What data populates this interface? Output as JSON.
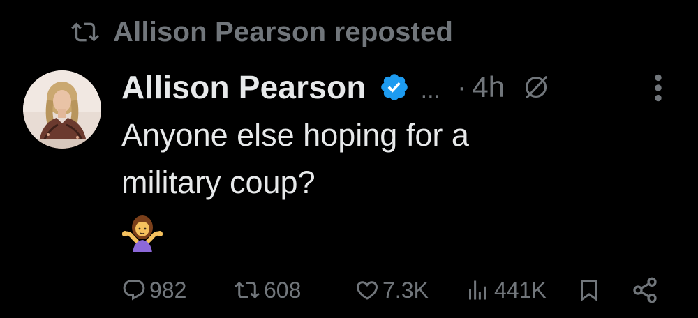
{
  "repost_banner": {
    "icon": "repost-icon",
    "text": "Allison Pearson reposted"
  },
  "post": {
    "author_name": "Allison Pearson",
    "verified_icon": "verified-badge-icon",
    "handle_truncated": "...",
    "separator": "·",
    "time": "4h",
    "grok_icon": "grok-icon",
    "more_icon": "more-options-icon",
    "text_line_1": "Anyone else hoping for a",
    "text_line_2": "military coup?",
    "emoji": "person-shrugging-emoji"
  },
  "actions": {
    "replies": "982",
    "reposts": "608",
    "likes": "7.3K",
    "views": "441K",
    "bookmark_icon": "bookmark-icon",
    "share_icon": "share-icon"
  },
  "colors": {
    "background": "#000000",
    "primary_text": "#e7e9ea",
    "secondary_text": "#71767b",
    "verified_blue": "#1d9bf0"
  }
}
